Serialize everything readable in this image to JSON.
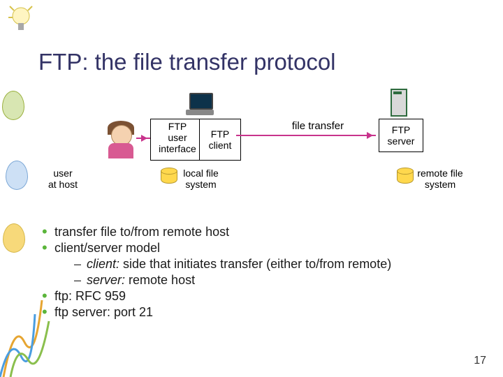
{
  "title": "FTP: the file transfer protocol",
  "diagram": {
    "user_at_host": "user\nat host",
    "ui_box": "FTP\nuser\ninterface",
    "client_box": "FTP\nclient",
    "transfer_label": "file transfer",
    "server_box": "FTP\nserver",
    "local_fs": "local file\nsystem",
    "remote_fs": "remote file\nsystem"
  },
  "bullets": [
    "transfer file to/from remote host",
    "client/server model",
    "ftp: RFC 959",
    "ftp server: port 21"
  ],
  "sub_bullets": [
    "client: side that initiates transfer (either to/from remote)",
    "server: remote host"
  ],
  "sub_emph": {
    "client": "client:",
    "server": "server:"
  },
  "page_number": "17"
}
